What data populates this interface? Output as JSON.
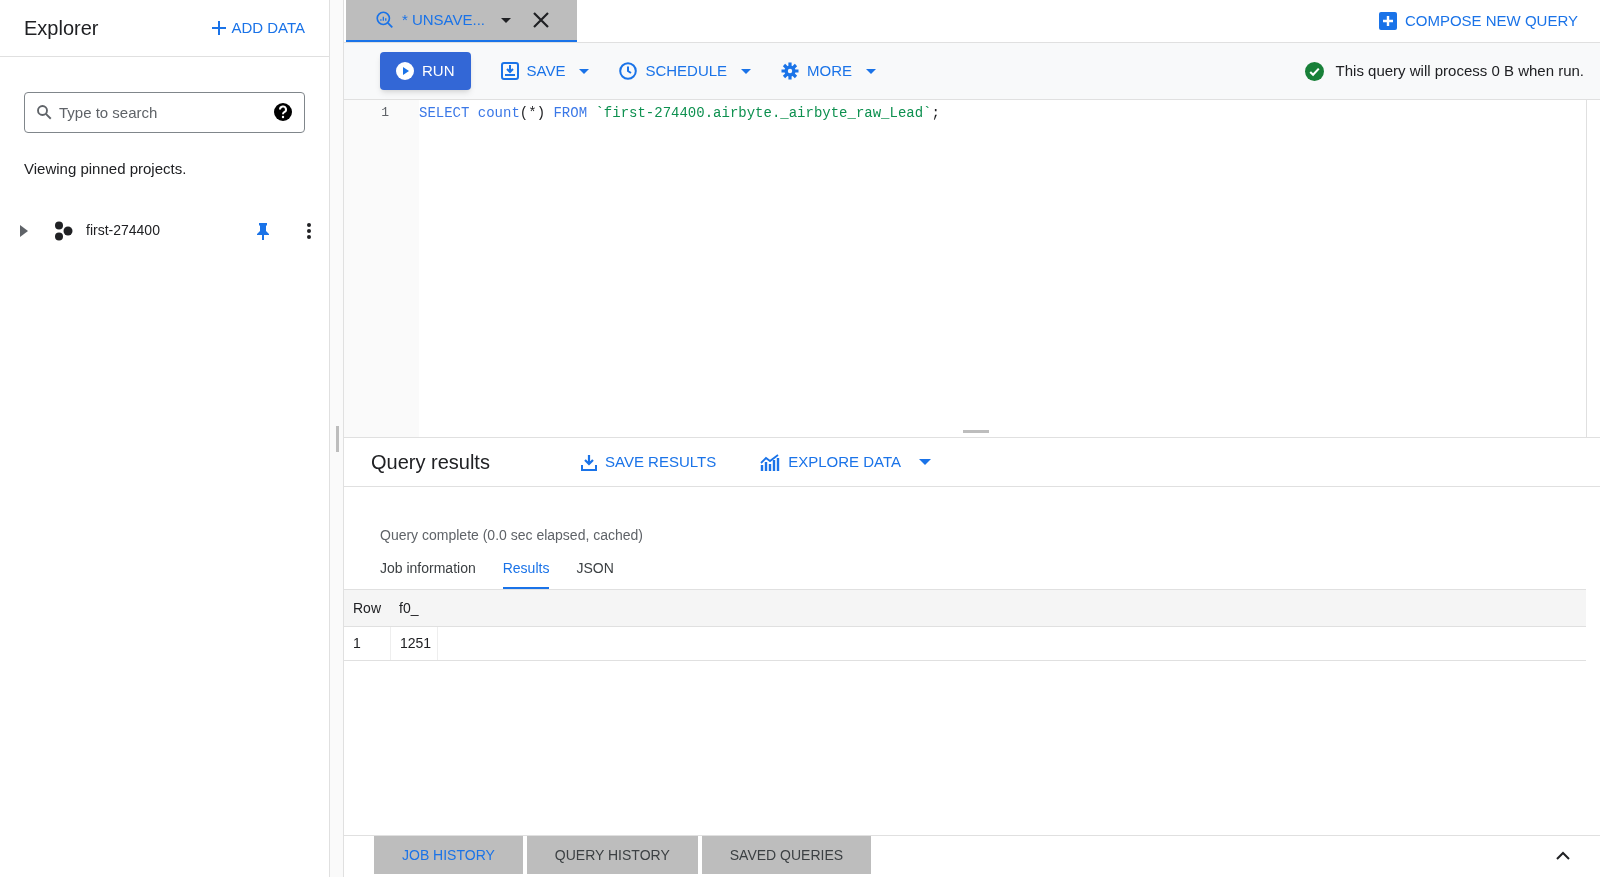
{
  "explorer": {
    "title": "Explorer",
    "add_data": "ADD DATA",
    "search": {
      "placeholder": "Type to search"
    },
    "note": "Viewing pinned projects.",
    "projects": [
      {
        "name": "first-274400",
        "expanded": false,
        "pinned": true
      }
    ]
  },
  "editor_tabs": [
    {
      "label": "* UNSAVE...",
      "selected": true
    }
  ],
  "compose": "COMPOSE NEW QUERY",
  "toolbar": {
    "buttons": [
      {
        "kind": "run",
        "label": "RUN"
      },
      {
        "kind": "save",
        "label": "SAVE"
      },
      {
        "kind": "schedule",
        "label": "SCHEDULE"
      },
      {
        "kind": "more",
        "label": "MORE"
      }
    ],
    "validation": "This query will process 0 B when run."
  },
  "editor": {
    "lines": [
      {
        "number": "1",
        "tokens": [
          {
            "kind": "keyword",
            "text": "SELECT "
          },
          {
            "kind": "keyword",
            "text": "count"
          },
          {
            "kind": "plain",
            "text": "(*) "
          },
          {
            "kind": "keyword",
            "text": "FROM "
          },
          {
            "kind": "string",
            "text": "`first-274400.airbyte._airbyte_raw_Lead`"
          },
          {
            "kind": "plain",
            "text": ";"
          }
        ]
      }
    ]
  },
  "results": {
    "title": "Query results",
    "actions": [
      {
        "kind": "save",
        "label": "SAVE RESULTS"
      },
      {
        "kind": "explore",
        "label": "EXPLORE DATA"
      }
    ],
    "status": "Query complete (0.0 sec elapsed, cached)",
    "tabs": [
      {
        "label": "Job information",
        "selected": false
      },
      {
        "label": "Results",
        "selected": true
      },
      {
        "label": "JSON",
        "selected": false
      }
    ],
    "table": {
      "columns": [
        "Row",
        "f0_"
      ],
      "rows": [
        [
          "1",
          "1251"
        ]
      ]
    }
  },
  "bottom_tabs": [
    {
      "label": "JOB HISTORY",
      "selected": true
    },
    {
      "label": "QUERY HISTORY",
      "selected": false
    },
    {
      "label": "SAVED QUERIES",
      "selected": false
    }
  ]
}
